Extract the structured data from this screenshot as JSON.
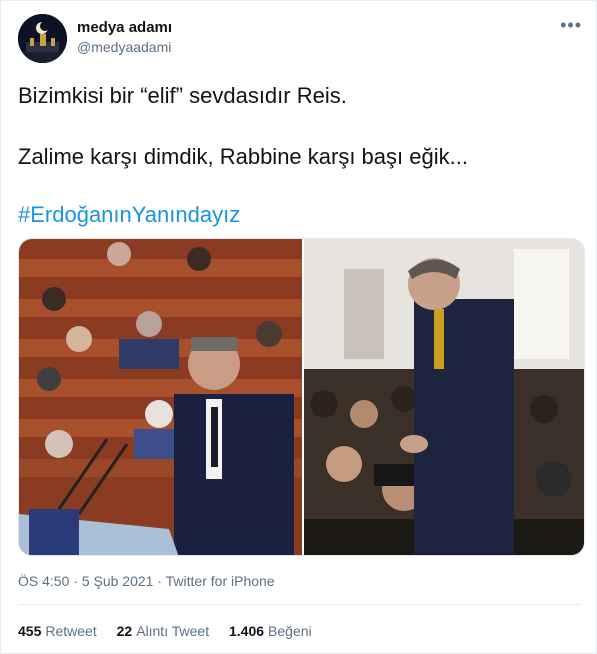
{
  "user": {
    "name": "medya adamı",
    "handle": "@medyaadami"
  },
  "tweet": {
    "line1": "Bizimkisi bir “elif” sevdasıdır Reis.",
    "line2": "Zalime karşı dimdik, Rabbine karşı başı eğik...",
    "hashtag": "#ErdoğanınYanındayız"
  },
  "meta": {
    "time": "ÖS 4:50",
    "sep1": " · ",
    "date": "5 Şub 2021",
    "sep2": " · ",
    "source": "Twitter for iPhone"
  },
  "stats": {
    "retweets_count": "455",
    "retweets_label": "Retweet",
    "quotes_count": "22",
    "quotes_label": "Alıntı Tweet",
    "likes_count": "1.406",
    "likes_label": "Beğeni"
  },
  "icons": {
    "more": "more-icon"
  },
  "colors": {
    "link": "#1b95e0",
    "secondary": "#5b7083",
    "text": "#0f1419"
  }
}
